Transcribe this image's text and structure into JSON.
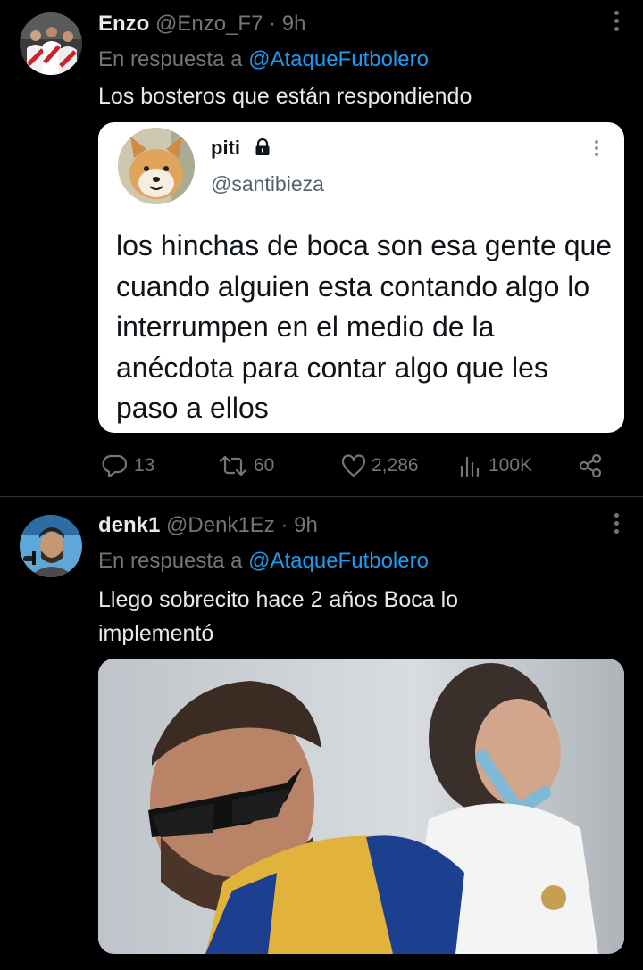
{
  "tweets": [
    {
      "display_name": "Enzo",
      "handle": "@Enzo_F7",
      "time": "· 9h",
      "reply_prefix": "En respuesta a",
      "reply_to": "@AtaqueFutbolero",
      "text": "Los bosteros que están respondiendo",
      "quote": {
        "name": "piti",
        "handle": "@santibieza",
        "text": "los hinchas de boca son esa gente que cuando alguien esta contando algo lo interrumpen en el medio de la anécdota para contar algo que les paso a ellos"
      },
      "stats": {
        "replies": "13",
        "retweets": "60",
        "likes": "2,286",
        "views": "100K"
      }
    },
    {
      "display_name": "denk1",
      "handle": "@Denk1Ez",
      "time": "· 9h",
      "reply_prefix": "En respuesta a",
      "reply_to": "@AtaqueFutbolero",
      "text": "Llego sobrecito hace 2 años Boca lo implementó"
    }
  ],
  "icons": [
    "reply-icon",
    "retweet-icon",
    "like-icon",
    "views-icon",
    "share-icon",
    "more-icon",
    "lock-icon"
  ],
  "colors": {
    "background": "#000000",
    "link": "#1d9bf0",
    "muted": "#71767b",
    "text": "#e7e9ea"
  }
}
